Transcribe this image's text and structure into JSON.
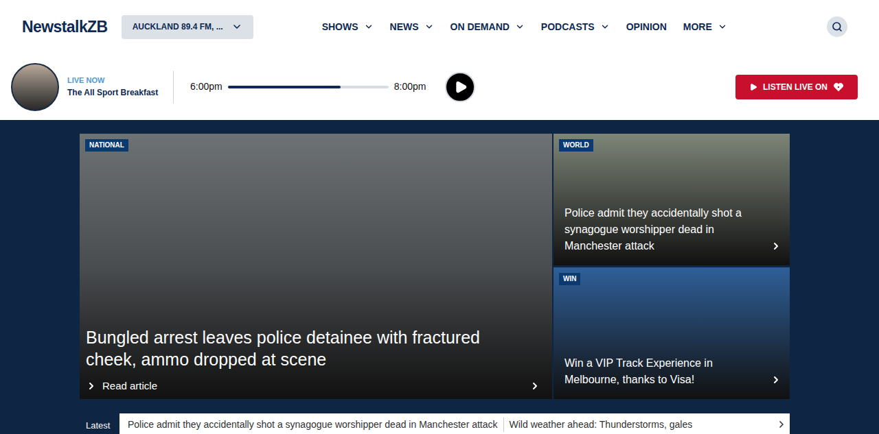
{
  "header": {
    "logo": "NewstalkZB",
    "station": "AUCKLAND 89.4 FM, ...",
    "nav": [
      {
        "label": "SHOWS",
        "dropdown": true
      },
      {
        "label": "NEWS",
        "dropdown": true
      },
      {
        "label": "ON DEMAND",
        "dropdown": true
      },
      {
        "label": "PODCASTS",
        "dropdown": true
      },
      {
        "label": "OPINION",
        "dropdown": false
      },
      {
        "label": "MORE",
        "dropdown": true
      }
    ]
  },
  "live": {
    "status": "LIVE NOW",
    "show": "The All Sport Breakfast",
    "start": "6:00pm",
    "end": "8:00pm",
    "level": 0.7,
    "listen": "LISTEN LIVE ON"
  },
  "hero": {
    "main": {
      "category": "NATIONAL",
      "title": "Bungled arrest leaves police detainee with fractured cheek, ammo dropped at scene",
      "cta": "Read article"
    },
    "side": [
      {
        "category": "WORLD",
        "title": "Police admit they accidentally shot a synagogue worshipper dead in Manchester attack",
        "color": "#7d8578"
      },
      {
        "category": "WIN",
        "title": "Win a VIP Track Experience in Melbourne, thanks to Visa!",
        "color": "#2f5f98"
      }
    ]
  },
  "latest": {
    "label": "Latest",
    "items": [
      "Police admit they accidentally shot a synagogue worshipper dead in Manchester attack",
      "Wild weather ahead: Thunderstorms, gales"
    ]
  }
}
